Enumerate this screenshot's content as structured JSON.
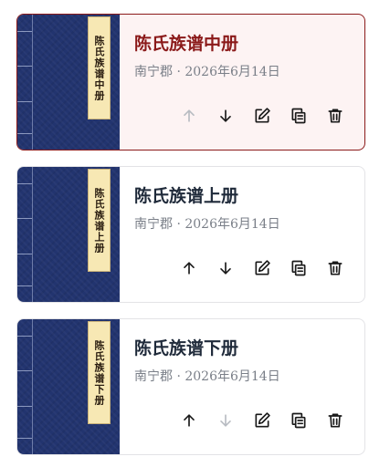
{
  "books": [
    {
      "cover_label": "陈氏族谱中册",
      "title": "陈氏族谱中册",
      "meta": "南宁郡 · 2026年6月14日",
      "selected": true,
      "move_up_enabled": false,
      "move_down_enabled": true
    },
    {
      "cover_label": "陈氏族谱上册",
      "title": "陈氏族谱上册",
      "meta": "南宁郡 · 2026年6月14日",
      "selected": false,
      "move_up_enabled": true,
      "move_down_enabled": true
    },
    {
      "cover_label": "陈氏族谱下册",
      "title": "陈氏族谱下册",
      "meta": "南宁郡 · 2026年6月14日",
      "selected": false,
      "move_up_enabled": true,
      "move_down_enabled": false
    }
  ],
  "colors": {
    "cover_blue": "#22346f",
    "label_paper": "#f7e8b4",
    "selected_accent": "#8b1a1a",
    "selected_background": "#fdf3f3"
  },
  "icons": [
    "arrow-up-icon",
    "arrow-down-icon",
    "edit-icon",
    "copy-icon",
    "trash-icon"
  ]
}
